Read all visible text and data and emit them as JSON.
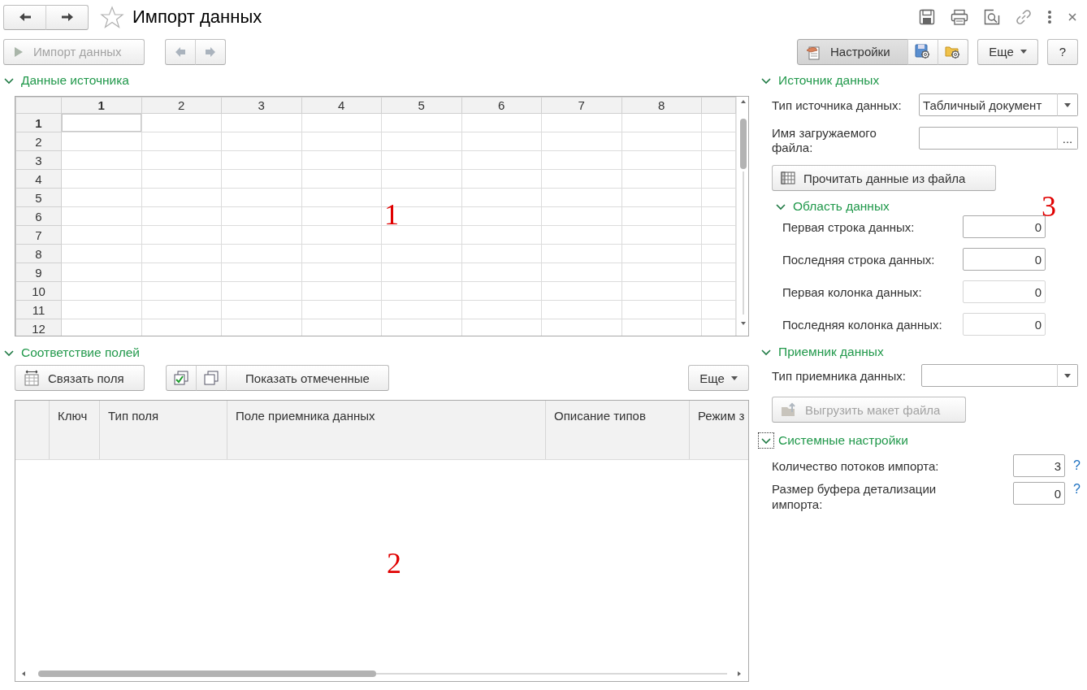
{
  "window": {
    "title": "Импорт данных",
    "favorite": false
  },
  "toolbar": {
    "import_button": {
      "label": "Импорт данных",
      "disabled": true
    },
    "nav_buttons": {
      "disabled": true
    },
    "settings_button": {
      "label": "Настройки",
      "pressed": true
    },
    "more_button": {
      "label": "Еще"
    },
    "help_button": {
      "label": "?"
    }
  },
  "source_data": {
    "title": "Данные источника",
    "expanded": true,
    "sheet": {
      "columns": [
        {
          "label": "1",
          "selected": true
        },
        {
          "label": "2",
          "selected": false
        },
        {
          "label": "3",
          "selected": false
        },
        {
          "label": "4",
          "selected": false
        },
        {
          "label": "5",
          "selected": false
        },
        {
          "label": "6",
          "selected": false
        },
        {
          "label": "7",
          "selected": false
        },
        {
          "label": "8",
          "selected": false
        }
      ],
      "rows": [
        {
          "label": "1",
          "selected": true
        },
        {
          "label": "2",
          "selected": false
        },
        {
          "label": "3",
          "selected": false
        },
        {
          "label": "4",
          "selected": false
        },
        {
          "label": "5",
          "selected": false
        },
        {
          "label": "6",
          "selected": false
        },
        {
          "label": "7",
          "selected": false
        },
        {
          "label": "8",
          "selected": false
        },
        {
          "label": "9",
          "selected": false
        },
        {
          "label": "10",
          "selected": false
        },
        {
          "label": "11",
          "selected": false
        },
        {
          "label": "12",
          "selected": false
        }
      ],
      "annotation": "1"
    }
  },
  "field_mapping": {
    "title": "Соответствие полей",
    "expanded": true,
    "link_button": {
      "label": "Связать поля"
    },
    "show_marked_button": {
      "label": "Показать отмеченные"
    },
    "more_button": {
      "label": "Еще"
    },
    "table": {
      "columns": [
        "Ключ",
        "Тип поля",
        "Поле приемника данных",
        "Описание типов",
        "Режим з"
      ]
    },
    "annotation": "2"
  },
  "data_source": {
    "title": "Источник данных",
    "expanded": true,
    "source_type": {
      "label": "Тип источника данных:",
      "value": "Табличный документ"
    },
    "file_name": {
      "label": "Имя загружаемого файла:",
      "button": "..."
    },
    "read_button": {
      "label": "Прочитать данные из файла"
    },
    "data_area": {
      "title": "Область данных",
      "expanded": true,
      "annotation": "3",
      "fields": [
        {
          "label": "Первая строка данных:",
          "value": "0",
          "disabled": false
        },
        {
          "label": "Последняя строка данных:",
          "value": "0",
          "disabled": false
        },
        {
          "label": "Первая колонка данных:",
          "value": "0",
          "disabled": true
        },
        {
          "label": "Последняя колонка данных:",
          "value": "0",
          "disabled": true
        }
      ]
    }
  },
  "data_receiver": {
    "title": "Приемник данных",
    "expanded": true,
    "receiver_type": {
      "label": "Тип приемника данных:"
    },
    "export_button": {
      "label": "Выгрузить макет файла",
      "disabled": true
    }
  },
  "system_settings": {
    "title": "Системные настройки",
    "expanded": true,
    "focused": true,
    "fields": [
      {
        "label": "Количество потоков импорта:",
        "value": "3",
        "help": "?"
      },
      {
        "label": "Размер буфера детализации импорта:",
        "value": "0",
        "help": "?"
      }
    ]
  }
}
